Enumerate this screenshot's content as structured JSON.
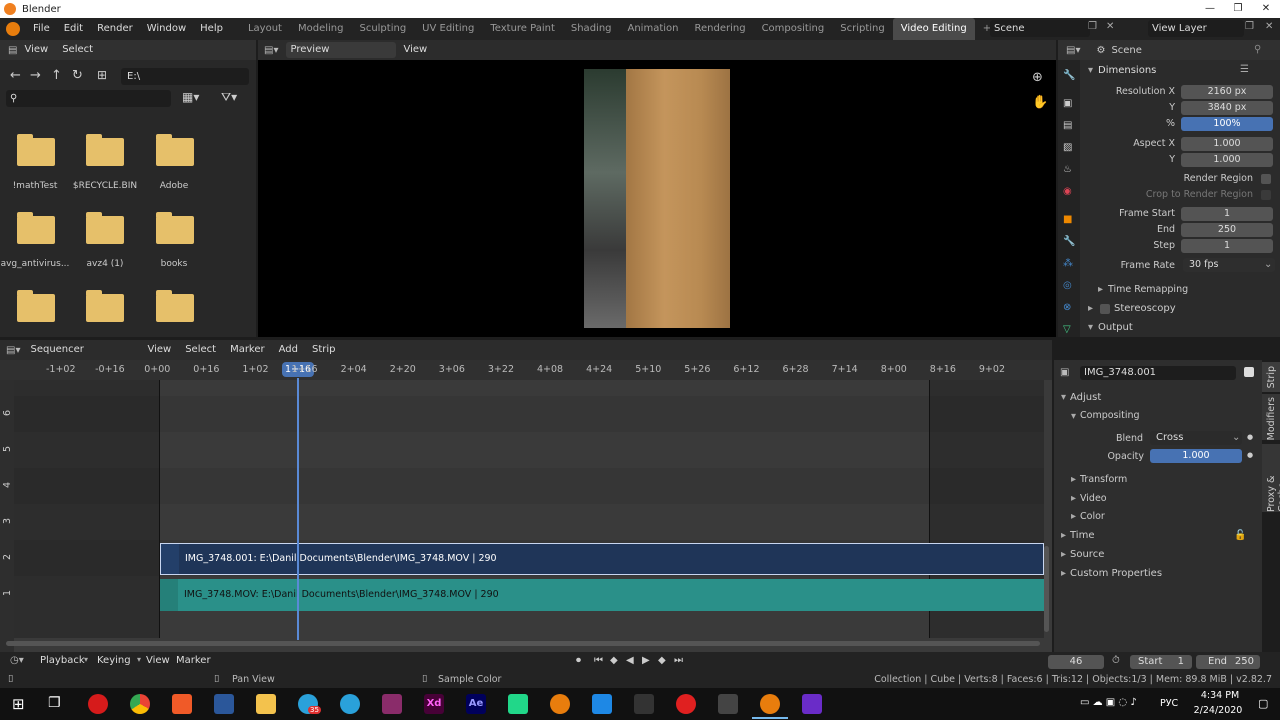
{
  "window": {
    "title": "Blender",
    "buttons": [
      "—",
      "❐",
      "✕"
    ]
  },
  "menu": [
    "File",
    "Edit",
    "Render",
    "Window",
    "Help"
  ],
  "workspaces": [
    "Layout",
    "Modeling",
    "Sculpting",
    "UV Editing",
    "Texture Paint",
    "Shading",
    "Animation",
    "Rendering",
    "Compositing",
    "Scripting",
    "Video Editing",
    "+"
  ],
  "active_workspace": "Video Editing",
  "scene": {
    "name": "Scene",
    "view_layer": "View Layer"
  },
  "file_browser": {
    "menu": [
      "View",
      "Select"
    ],
    "path": "E:\\",
    "nav": [
      "←",
      "→",
      "↑",
      "↻"
    ],
    "folders": [
      "!mathTest",
      "$RECYCLE.BIN",
      "Adobe",
      "avg_antivirus...",
      "avz4 (1)",
      "books",
      "",
      "",
      ""
    ]
  },
  "preview": {
    "mode": "Preview",
    "menu_view": "View"
  },
  "properties": {
    "scene_label": "Scene",
    "section": "Dimensions",
    "fields": [
      {
        "label": "Resolution X",
        "value": "2160 px"
      },
      {
        "label": "Y",
        "value": "3840 px"
      },
      {
        "label": "%",
        "value": "100%"
      },
      {
        "label": "Aspect X",
        "value": "1.000"
      },
      {
        "label": "Y",
        "value": "1.000"
      },
      {
        "label": "Frame Start",
        "value": "1"
      },
      {
        "label": "End",
        "value": "250"
      },
      {
        "label": "Step",
        "value": "1"
      },
      {
        "label": "Frame Rate",
        "value": "30 fps"
      }
    ],
    "render_region": "Render Region",
    "crop_region": "Crop to Render Region",
    "time_remapping": "Time Remapping",
    "stereoscopy": "Stereoscopy",
    "output": "Output"
  },
  "sequencer": {
    "mode": "Sequencer",
    "menu": [
      "View",
      "Select",
      "Marker",
      "Add",
      "Strip"
    ],
    "ticks": [
      "-1+02",
      "-0+16",
      "0+00",
      "0+16",
      "1+02",
      "1+16",
      "2+04",
      "2+20",
      "3+06",
      "3+22",
      "4+08",
      "4+24",
      "5+10",
      "5+26",
      "6+12",
      "6+28",
      "7+14",
      "8+00",
      "8+16",
      "9+02"
    ],
    "current": "1+16",
    "channels": [
      "6",
      "5",
      "4",
      "3",
      "2",
      "1"
    ],
    "strip_top": "IMG_3748.001: E:\\Danil Documents\\Blender\\IMG_3748.MOV | 290",
    "strip_bottom": "IMG_3748.MOV: E:\\Danil Documents\\Blender\\IMG_3748.MOV | 290"
  },
  "strip_panel": {
    "name": "IMG_3748.001",
    "adjust": "Adjust",
    "compositing": "Compositing",
    "blend_label": "Blend",
    "blend": "Cross",
    "opacity_label": "Opacity",
    "opacity": "1.000",
    "sub": [
      "Transform",
      "Video",
      "Color"
    ],
    "sections": [
      "Time",
      "Source",
      "Custom Properties"
    ],
    "tabs": [
      "Strip",
      "Modifiers",
      "Proxy & Cache"
    ]
  },
  "timeline": {
    "menu": [
      "Playback",
      "Keying",
      "View",
      "Marker"
    ],
    "frame": "46",
    "start_label": "Start",
    "start": "1",
    "end_label": "End",
    "end": "250"
  },
  "status": {
    "left": "Pan View",
    "mid": "Sample Color",
    "right": "Collection | Cube | Verts:8 | Faces:6 | Tris:12 | Objects:1/3 | Mem: 89.8 MiB | v2.82.7"
  },
  "taskbar": {
    "time": "4:34 PM",
    "date": "2/24/2020",
    "lang": "РУС",
    "ae_label": "Ae",
    "xd_label": "Xd",
    "badge": "35"
  }
}
